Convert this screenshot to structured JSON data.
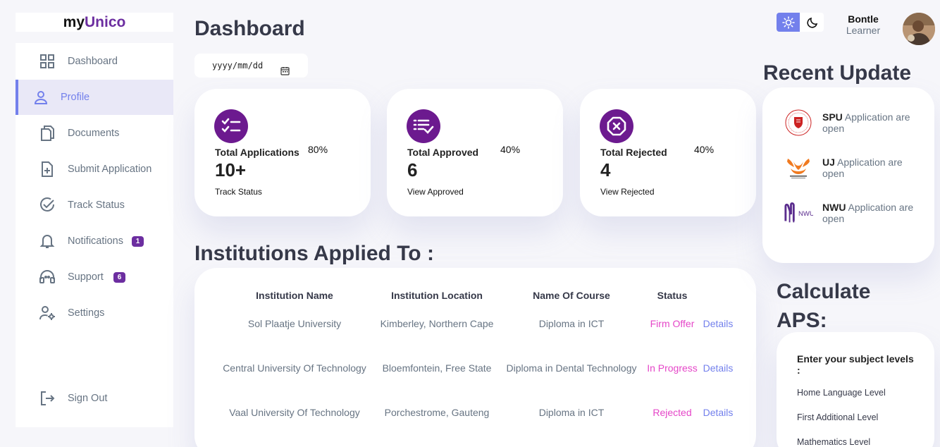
{
  "brand": {
    "prefix": "my",
    "accent": "Unico"
  },
  "sidebar": {
    "items": [
      {
        "label": "Dashboard",
        "icon": "grid-icon"
      },
      {
        "label": "Profile",
        "icon": "user-icon"
      },
      {
        "label": "Documents",
        "icon": "documents-icon"
      },
      {
        "label": "Submit Application",
        "icon": "file-plus-icon"
      },
      {
        "label": "Track Status",
        "icon": "check-circle-icon"
      },
      {
        "label": "Notifications",
        "icon": "bell-icon",
        "badge": "1"
      },
      {
        "label": "Support",
        "icon": "headset-icon",
        "badge": "6"
      },
      {
        "label": "Settings",
        "icon": "user-settings-icon"
      }
    ],
    "active_index": 1,
    "sign_out": "Sign Out"
  },
  "header": {
    "title": "Dashboard",
    "date_placeholder": "yyyy/mm/dd",
    "user_name": "Bontle",
    "user_role": "Learner"
  },
  "stats": [
    {
      "title": "Total Applications",
      "percent": "80%",
      "value": "10+",
      "link": "Track Status",
      "icon": "checklist-icon"
    },
    {
      "title": "Total Approved",
      "percent": "40%",
      "value": "6",
      "link": "View Approved",
      "icon": "list-check-icon"
    },
    {
      "title": "Total Rejected",
      "percent": "40%",
      "value": "4",
      "link": "View Rejected",
      "icon": "x-octagon-icon"
    }
  ],
  "institutions": {
    "title": "Institutions Applied To :",
    "columns": [
      "Institution Name",
      "Institution Location",
      "Name Of Course",
      "Status"
    ],
    "rows": [
      {
        "name": "Sol Plaatje University",
        "location": "Kimberley, Northern Cape",
        "course": "Diploma in ICT",
        "status": "Firm Offer",
        "action": "Details"
      },
      {
        "name": "Central University Of Technology",
        "location": "Bloemfontein, Free State",
        "course": "Diploma in Dental Technology",
        "status": "In Progress",
        "action": "Details"
      },
      {
        "name": "Vaal University Of Technology",
        "location": "Porchestrome, Gauteng",
        "course": "Diploma in ICT",
        "status": "Rejected",
        "action": "Details"
      }
    ]
  },
  "recent_updates": {
    "title": "Recent Update",
    "items": [
      {
        "name": "SPU",
        "text": " Application are open",
        "logo": "spu-logo"
      },
      {
        "name": "UJ",
        "text": " Application are open",
        "logo": "uj-logo"
      },
      {
        "name": "NWU",
        "text": " Application are open",
        "logo": "nwu-logo"
      }
    ]
  },
  "aps": {
    "title": "Calculate APS:",
    "heading": "Enter your subject levels :",
    "levels": [
      "Home Language Level",
      "First Additional Level",
      "Mathematics Level"
    ]
  },
  "colors": {
    "primary": "#7380ec",
    "purple": "#6c1a8f",
    "status": "#e546c8",
    "bg": "#f6f6fa"
  }
}
